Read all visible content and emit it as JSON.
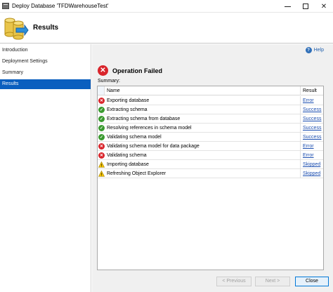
{
  "window": {
    "title": "Deploy Database 'TFDWarehouseTest'"
  },
  "header": {
    "title": "Results"
  },
  "sidebar": {
    "items": [
      {
        "label": "Introduction",
        "selected": false
      },
      {
        "label": "Deployment Settings",
        "selected": false
      },
      {
        "label": "Summary",
        "selected": false
      },
      {
        "label": "Results",
        "selected": true
      }
    ]
  },
  "main": {
    "help_label": "Help",
    "operation_status": "Operation Failed",
    "summary_label": "Summary:",
    "table": {
      "columns": [
        "Name",
        "Result"
      ],
      "rows": [
        {
          "status": "error",
          "name": "Exporting database",
          "result": "Error"
        },
        {
          "status": "success",
          "name": "Extracting schema",
          "result": "Success"
        },
        {
          "status": "success",
          "name": "Extracting schema from database",
          "result": "Success"
        },
        {
          "status": "success",
          "name": "Resolving references in schema model",
          "result": "Success"
        },
        {
          "status": "success",
          "name": "Validating schema model",
          "result": "Success"
        },
        {
          "status": "error",
          "name": "Validating schema model for data package",
          "result": "Error"
        },
        {
          "status": "error",
          "name": "Validating schema",
          "result": "Error"
        },
        {
          "status": "warning",
          "name": "Importing database",
          "result": "Skipped"
        },
        {
          "status": "warning",
          "name": "Refreshing Object Explorer",
          "result": "Skipped"
        }
      ]
    }
  },
  "buttons": {
    "previous": "< Previous",
    "next": "Next >",
    "close": "Close"
  },
  "colors": {
    "selection": "#0b5fbf",
    "error": "#d9242b",
    "success": "#3a9a2f",
    "warning": "#f2c200",
    "link": "#1d4fb0"
  }
}
